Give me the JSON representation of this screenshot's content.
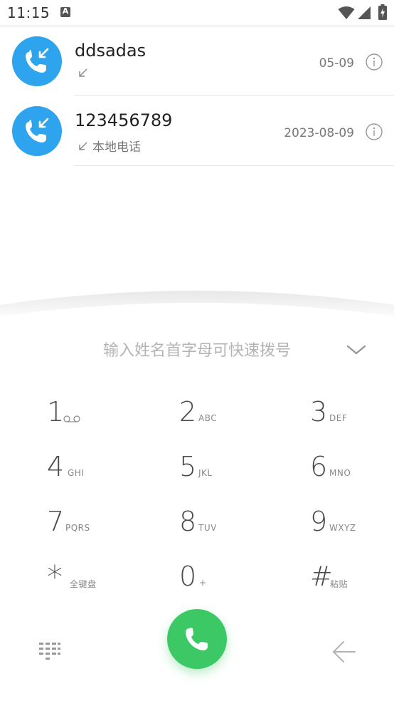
{
  "status_bar": {
    "time": "11:15",
    "notification_icon": "a-icon",
    "icons": [
      "wifi-icon",
      "signal-icon",
      "battery-charging-icon"
    ]
  },
  "calls": [
    {
      "name": "ddsadas",
      "type_icon": "incoming-call-arrow-icon",
      "label": "",
      "date": "05-09"
    },
    {
      "name": "123456789",
      "type_icon": "incoming-call-arrow-icon",
      "label": "本地电话",
      "date": "2023-08-09"
    }
  ],
  "dialer": {
    "search_placeholder": "输入姓名首字母可快速拨号",
    "keys": [
      {
        "digit": "1",
        "letters": ""
      },
      {
        "digit": "2",
        "letters": "ABC"
      },
      {
        "digit": "3",
        "letters": "DEF"
      },
      {
        "digit": "4",
        "letters": "GHI"
      },
      {
        "digit": "5",
        "letters": "JKL"
      },
      {
        "digit": "6",
        "letters": "MNO"
      },
      {
        "digit": "7",
        "letters": "PQRS"
      },
      {
        "digit": "8",
        "letters": "TUV"
      },
      {
        "digit": "9",
        "letters": "WXYZ"
      },
      {
        "digit": "*",
        "letters": "全键盘"
      },
      {
        "digit": "0",
        "letters": "+"
      },
      {
        "digit": "#",
        "letters": "粘贴"
      }
    ],
    "colors": {
      "call_green": "#3cc965",
      "avatar_blue": "#2fa4ee"
    }
  }
}
